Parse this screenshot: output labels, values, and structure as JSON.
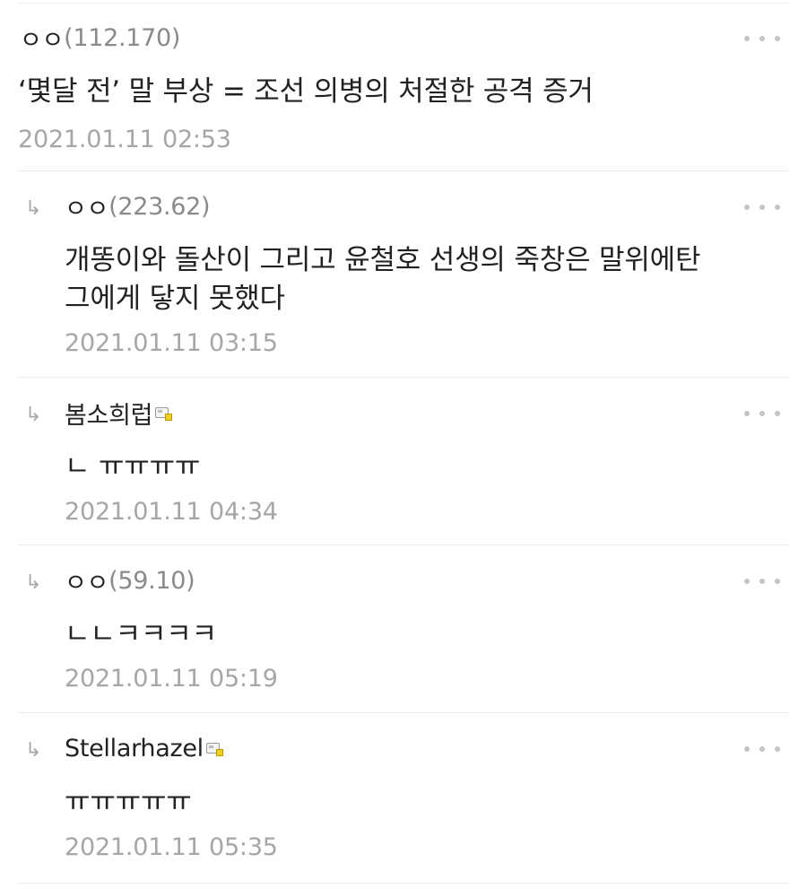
{
  "comments": [
    {
      "author": "ㅇㅇ",
      "ip": "(112.170)",
      "text": "‘몇달 전’ 말 부상 = 조선 의병의 처절한 공격 증거",
      "date": "2021.01.11 02:53",
      "is_reply": false,
      "member_badge": false
    },
    {
      "author": "ㅇㅇ",
      "ip": "(223.62)",
      "text": "개똥이와 돌산이 그리고 윤철호 선생의 죽창은 말위에탄\n그에게 닿지 못했다",
      "date": "2021.01.11 03:15",
      "is_reply": true,
      "member_badge": false
    },
    {
      "author": "봄소희럽",
      "ip": "",
      "text": "ㄴ ㅠㅠㅠㅠ",
      "date": "2021.01.11 04:34",
      "is_reply": true,
      "member_badge": true
    },
    {
      "author": "ㅇㅇ",
      "ip": "(59.10)",
      "text": "ㄴㄴㅋㅋㅋㅋ",
      "date": "2021.01.11 05:19",
      "is_reply": true,
      "member_badge": false
    },
    {
      "author": "Stellarhazel",
      "ip": "",
      "text": "ㅠㅠㅠㅠㅠ",
      "date": "2021.01.11 05:35",
      "is_reply": true,
      "member_badge": true
    }
  ],
  "icons": {
    "reply": "reply-arrow-icon",
    "more": "more-dots-icon",
    "member": "member-badge-icon"
  },
  "reply_arrow_glyph": "↳",
  "colors": {
    "author": "#222222",
    "ip": "#8a8a8a",
    "date": "#a6a6a6",
    "divider": "#ececec",
    "dots": "#c4c4c4",
    "badge": "#f1cf1f"
  }
}
